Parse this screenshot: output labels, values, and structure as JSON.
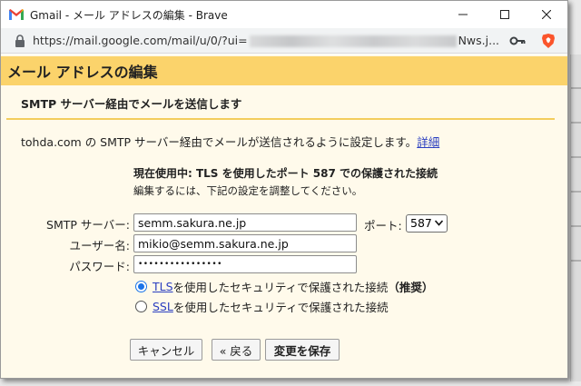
{
  "window": {
    "title": "Gmail - メール アドレスの編集 - Brave",
    "url_prefix": "https://mail.google.com/mail/u/0/?ui=",
    "url_suffix": "Nws.j..."
  },
  "dialog": {
    "header": "メール アドレスの編集",
    "section_title": "SMTP サーバー経由でメールを送信します",
    "description": "tohda.com の SMTP サーバー経由でメールが送信されるように設定します。",
    "details_link": "詳細",
    "status_main": "現在使用中: TLS を使用したポート 587 での保護された接続",
    "status_sub": "編集するには、下記の設定を調整してください。"
  },
  "form": {
    "smtp_label": "SMTP サーバー:",
    "smtp_value": "semm.sakura.ne.jp",
    "port_label": "ポート:",
    "port_value": "587",
    "user_label": "ユーザー名:",
    "user_value": "mikio@semm.sakura.ne.jp",
    "password_label": "パスワード:",
    "password_value": "••••••••••••••••",
    "tls_name": "TLS",
    "tls_text": " を使用したセキュリティで保護された接続",
    "tls_recommended": "（推奨）",
    "ssl_name": "SSL",
    "ssl_text": " を使用したセキュリティで保護された接続",
    "selected": "TLS"
  },
  "buttons": {
    "cancel": "キャンセル",
    "back": "« 戻る",
    "save": "変更を保存"
  },
  "colors": {
    "header_bg": "#fbd36b",
    "panel_bg": "#fffaeb",
    "link": "#2a3ec0",
    "divider": "#f3cd5d"
  }
}
